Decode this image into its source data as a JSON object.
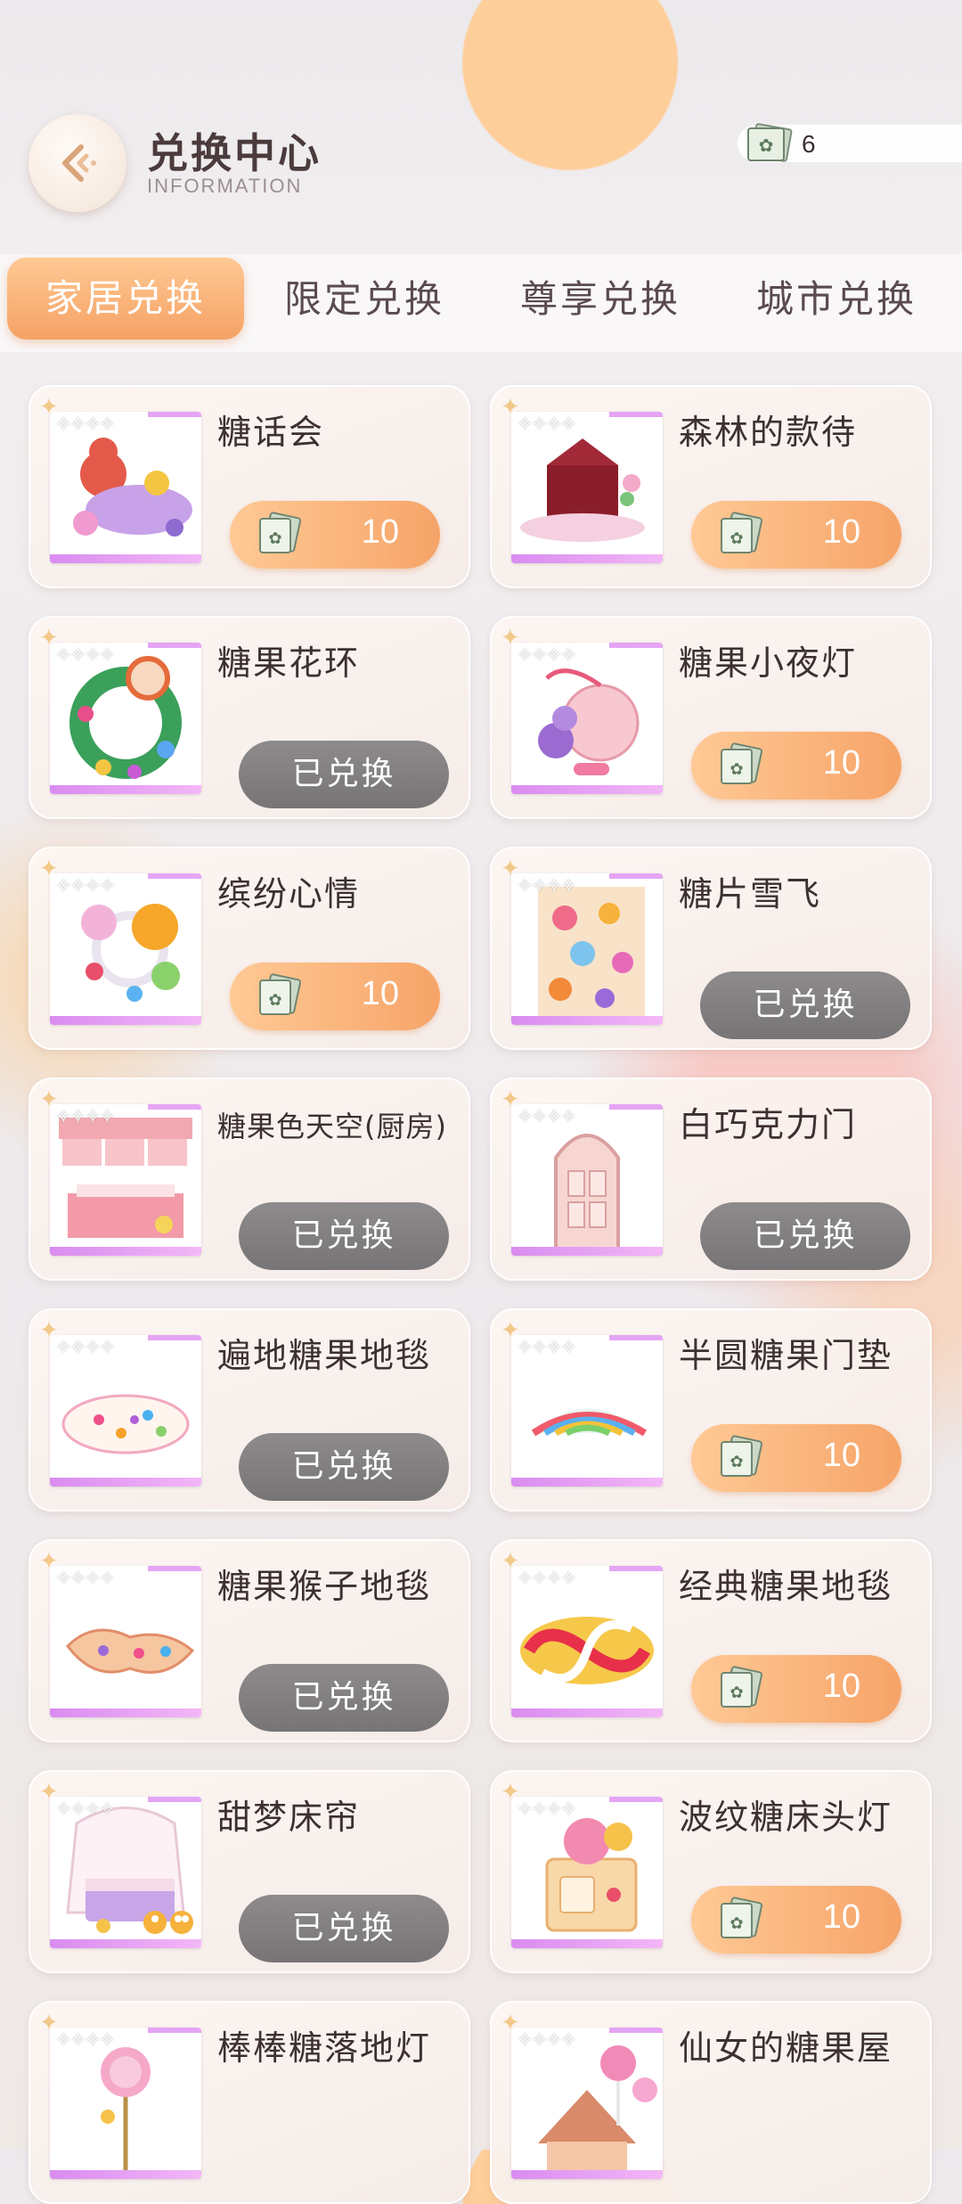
{
  "header": {
    "title": "兑换中心",
    "subtitle": "INFORMATION",
    "currency_count": "6"
  },
  "tabs": [
    {
      "label": "家居兑换",
      "active": true
    },
    {
      "label": "限定兑换",
      "active": false
    },
    {
      "label": "尊享兑换",
      "active": false
    },
    {
      "label": "城市兑换",
      "active": false
    }
  ],
  "items": [
    {
      "name": "糖话会",
      "status": "price",
      "price": "10"
    },
    {
      "name": "森林的款待",
      "status": "price",
      "price": "10"
    },
    {
      "name": "糖果花环",
      "status": "done",
      "done_label": "已兑换"
    },
    {
      "name": "糖果小夜灯",
      "status": "price",
      "price": "10"
    },
    {
      "name": "缤纷心情",
      "status": "price",
      "price": "10"
    },
    {
      "name": "糖片雪飞",
      "status": "done",
      "done_label": "已兑换"
    },
    {
      "name": "糖果色天空(厨房)",
      "status": "done",
      "done_label": "已兑换"
    },
    {
      "name": "白巧克力门",
      "status": "done",
      "done_label": "已兑换"
    },
    {
      "name": "遍地糖果地毯",
      "status": "done",
      "done_label": "已兑换"
    },
    {
      "name": "半圆糖果门垫",
      "status": "price",
      "price": "10"
    },
    {
      "name": "糖果猴子地毯",
      "status": "done",
      "done_label": "已兑换"
    },
    {
      "name": "经典糖果地毯",
      "status": "price",
      "price": "10"
    },
    {
      "name": "甜梦床帘",
      "status": "done",
      "done_label": "已兑换"
    },
    {
      "name": "波纹糖床头灯",
      "status": "price",
      "price": "10"
    },
    {
      "name": "棒棒糖落地灯",
      "status": "partial"
    },
    {
      "name": "仙女的糖果屋",
      "status": "partial"
    }
  ]
}
